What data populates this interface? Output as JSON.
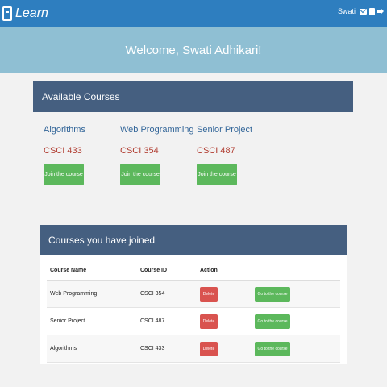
{
  "navbar": {
    "brand": "Learn",
    "user": "Swati"
  },
  "hero": {
    "title": "Welcome, Swati Adhikari!"
  },
  "available": {
    "heading": "Available Courses",
    "courses": [
      {
        "name": "Algorithms",
        "code": "CSCI 433",
        "button": "Join the course"
      },
      {
        "name": "Web Programming",
        "code": "CSCI 354",
        "button": "Join the course"
      },
      {
        "name": "Senior Project",
        "code": "CSCI 487",
        "button": "Join the course"
      }
    ]
  },
  "joined": {
    "heading": "Courses you have joined",
    "columns": [
      "Course Name",
      "Course ID",
      "Action"
    ],
    "rows": [
      {
        "name": "Web Programming",
        "id": "CSCI 354",
        "delete": "Delete",
        "go": "Go to the course"
      },
      {
        "name": "Senior Project",
        "id": "CSCI 487",
        "delete": "Delete",
        "go": "Go to the course"
      },
      {
        "name": "Algorithms",
        "id": "CSCI 433",
        "delete": "Delete",
        "go": "Go to the course"
      }
    ]
  },
  "colors": {
    "navbar": "#2e7ebf",
    "hero": "#8fbfd3",
    "panel_heading": "#455f80",
    "success": "#5cb85c",
    "danger": "#d9534f"
  },
  "icons": [
    "book-icon",
    "mail-icon",
    "book-small-icon",
    "logout-icon"
  ]
}
